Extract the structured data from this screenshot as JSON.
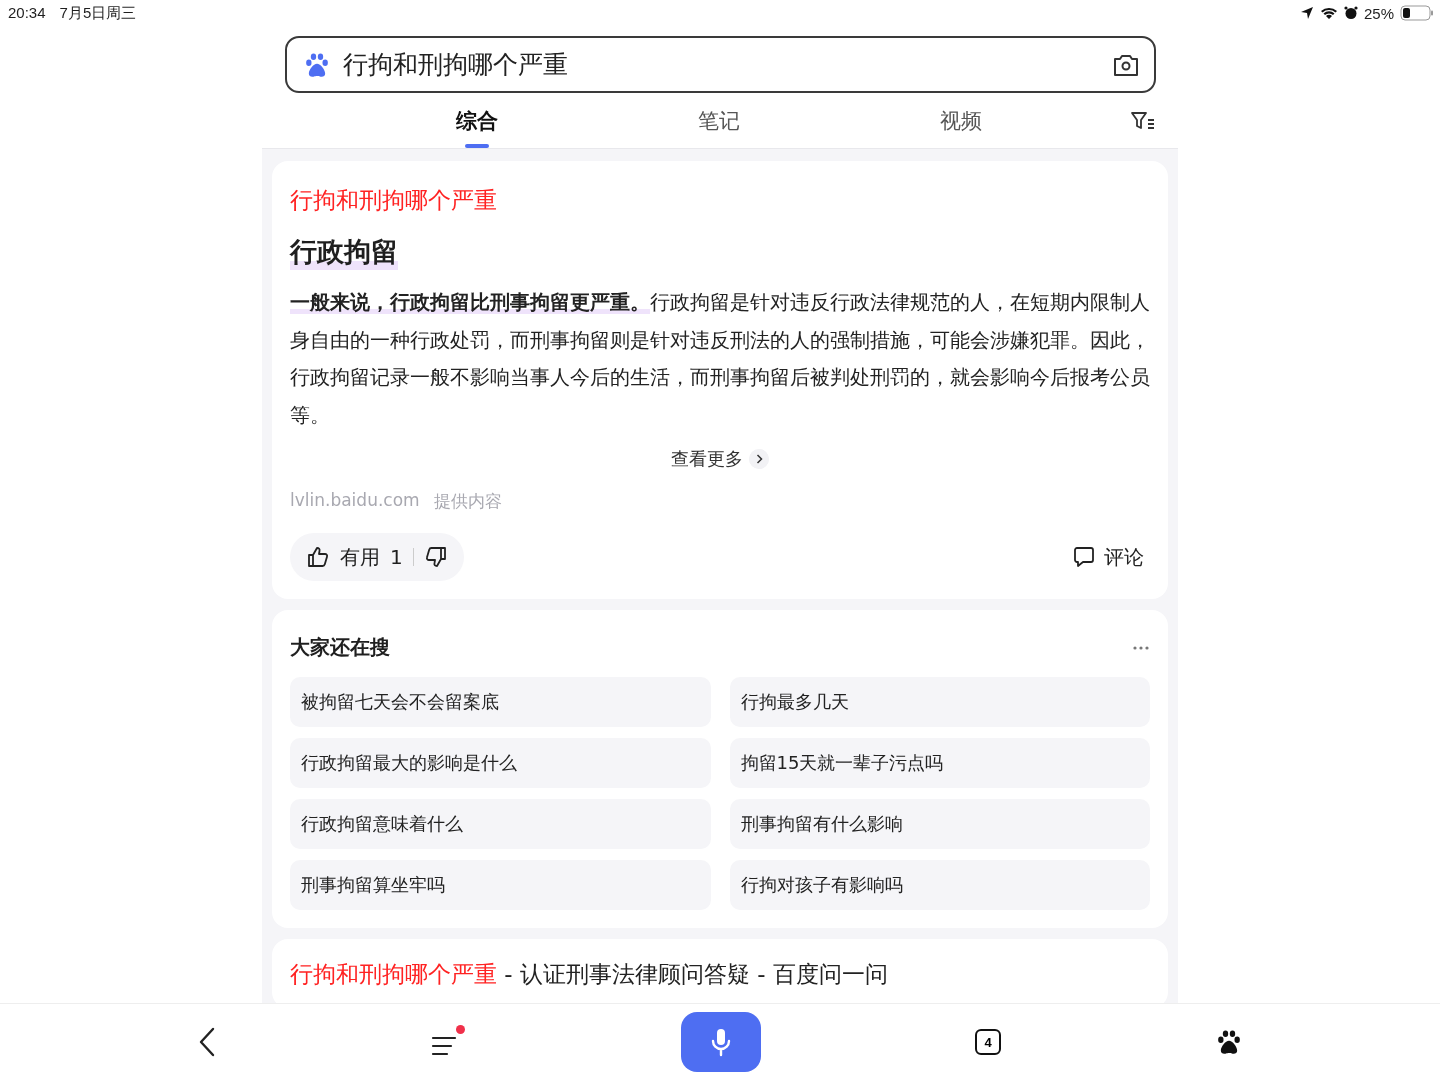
{
  "status_bar": {
    "time": "20:34",
    "date": "7月5日周三",
    "battery": "25%"
  },
  "search": {
    "value": "行拘和刑拘哪个严重"
  },
  "tabs": [
    {
      "label": "综合",
      "selected": true
    },
    {
      "label": "笔记",
      "selected": false
    },
    {
      "label": "视频",
      "selected": false
    }
  ],
  "answer_card": {
    "query": "行拘和刑拘哪个严重",
    "heading": "行政拘留",
    "text": "**一般来说，行政拘留比刑事拘留更严重。**行政拘留是针对违反行政法律规范的人，在短期内限制人身自由的一种行政处罚，而刑事拘留则是针对违反刑法的人的强制措施，可能会涉嫌犯罪。因此，行政拘留记录一般不影响当事人今后的生活，而刑事拘留后被判处刑罚的，就会影响今后报考公员等。",
    "more": "查看更多",
    "source": "lvlin.baidu.com",
    "source_note": "提供内容",
    "useful_label": "有用",
    "useful_count": "1",
    "comment": "评论"
  },
  "related": {
    "title": "大家还在搜",
    "items": [
      "被拘留七天会不会留案底",
      "行拘最多几天",
      "行政拘留最大的影响是什么",
      "拘留15天就一辈子污点吗",
      "行政拘留意味着什么",
      "刑事拘留有什么影响",
      "刑事拘留算坐牢吗",
      "行拘对孩子有影响吗"
    ]
  },
  "result": {
    "title_highlight": "行拘和刑拘哪个严重",
    "title_rest": " - 认证刑事法律顾问答疑 - 百度问一问"
  },
  "bottom_nav": {
    "menu_badge": true,
    "tab_count": "4"
  }
}
